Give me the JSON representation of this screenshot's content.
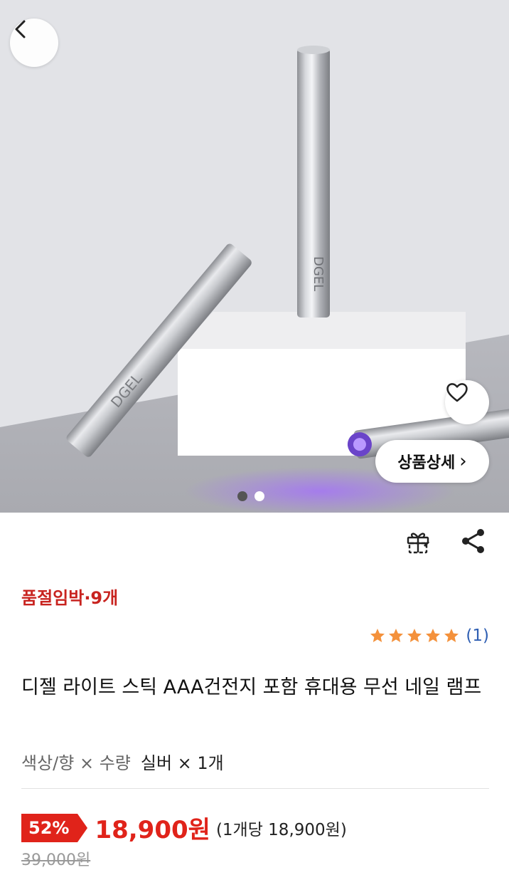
{
  "hero": {
    "product_brand_mark": "DGEL",
    "detail_button_label": "상품상세",
    "detail_button_chevron": "›",
    "slide_count": 2,
    "active_slide": 1
  },
  "icons": {
    "back": "chevron-left-icon",
    "like": "heart-icon",
    "gift": "gift-icon",
    "share": "share-icon",
    "star": "star-icon"
  },
  "product": {
    "stock_notice": "품절임박·9개",
    "rating_stars": 5,
    "rating_count": "(1)",
    "title": "디젤 라이트 스틱 AAA건전지 포함 휴대용 무선 네일 램프",
    "option_label": "색상/향 × 수량",
    "option_value": "실버 × 1개"
  },
  "price": {
    "discount": "52%",
    "sale_price": "18,900원",
    "unit_price": "(1개당 18,900원)",
    "original_price": "39,000원"
  },
  "colors": {
    "accent_red": "#e0231a",
    "stock_red": "#c8231f",
    "star_orange": "#f4913b",
    "link_blue": "#2f5fb3"
  }
}
